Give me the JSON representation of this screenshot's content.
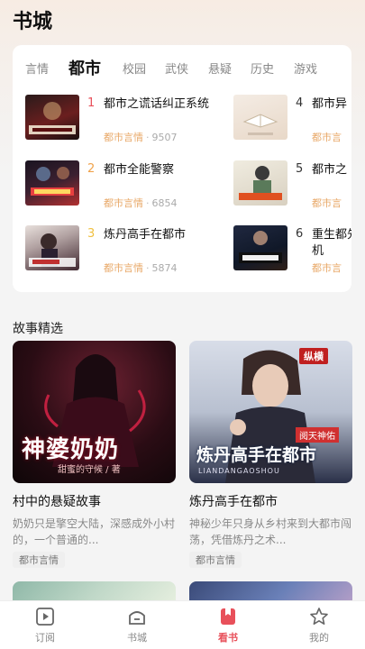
{
  "page": {
    "title": "书城"
  },
  "categories": {
    "tabs": [
      "言情",
      "都市",
      "校园",
      "武侠",
      "悬疑",
      "历史",
      "游戏"
    ],
    "active": "都市"
  },
  "ranking": [
    {
      "rank": "1",
      "title": "都市之谎话纠正系统",
      "tag": "都市言情",
      "count": "9507"
    },
    {
      "rank": "2",
      "title": "都市全能警察",
      "tag": "都市言情",
      "count": "6854"
    },
    {
      "rank": "3",
      "title": "炼丹高手在都市",
      "tag": "都市言情",
      "count": "5874"
    },
    {
      "rank": "4",
      "title": "都市异",
      "tag": "都市言"
    },
    {
      "rank": "5",
      "title": "都市之",
      "tag": "都市言"
    },
    {
      "rank": "6",
      "title": "重生都先机",
      "tag": "都市言"
    }
  ],
  "rank_colors": {
    "top": "#e8505a",
    "second": "#f0a24a",
    "third": "#f0c040",
    "rest": "#333333"
  },
  "section": {
    "title": "故事精选"
  },
  "stories": [
    {
      "title": "村中的悬疑故事",
      "desc": "奶奶只是擎空大陆，深感成外小村的，一个普通的...",
      "tag": "都市言情",
      "poster_text": "神婆奶奶",
      "poster_sub": "甜蜜的守候 / 著"
    },
    {
      "title": "炼丹高手在都市",
      "desc": "神秘少年只身从乡村来到大都市闯荡，凭借炼丹之术...",
      "tag": "都市言情",
      "poster_text": "炼丹高手在都市",
      "poster_sub": "LIANDANGAOSHOU",
      "poster_badge": "阅天神佑",
      "poster_brand": "纵横"
    }
  ],
  "tabbar": {
    "items": [
      "订阅",
      "书城",
      "看书",
      "我的"
    ],
    "active": "看书"
  }
}
